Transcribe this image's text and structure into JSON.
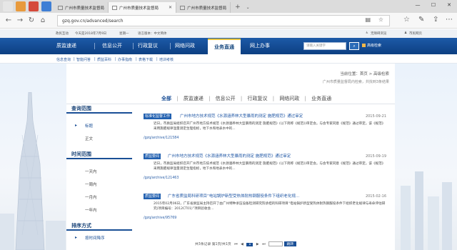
{
  "browser": {
    "tabs": [
      {
        "label": "广州市质量技术监督局",
        "active": false
      },
      {
        "label": "广州市质量技术监督局",
        "active": true
      },
      {
        "label": "广州市质量技术监督局",
        "active": false
      }
    ],
    "url": "gzq.gov.cn/advanced/search"
  },
  "topstrip": {
    "site": "政民互动",
    "date": "今天是2018年7月9日",
    "weekday": "星期一",
    "lang": "语言版本：中文简体",
    "accessible": "无障碍浏览",
    "site_visit": "市民网页"
  },
  "nav": {
    "items": [
      "质监速递",
      "信息公开",
      "行政复议",
      "网络问政",
      "业务直通",
      "网上办事"
    ],
    "search_placeholder": "请输入关键字",
    "advanced": "高级检索"
  },
  "subnav": [
    "信息查询",
    "智能问答",
    "质监百科",
    "办事指南",
    "表格下载",
    "培训考核"
  ],
  "breadcrumb": "当前位置：首页 > 高级检索",
  "crumb_sub": "广州市质量监督局内检索，共找到3条结果",
  "categories": [
    "全部",
    "质监速递",
    "信息公开",
    "行政复议",
    "网络问政",
    "业务直通"
  ],
  "sidebar": {
    "scope_title": "查询范围",
    "scope_items": [
      "标题",
      "正文"
    ],
    "time_title": "时间范围",
    "time_items": [
      "一天内",
      "一周内",
      "一月内",
      "一年内"
    ],
    "sort_title": "排序方式",
    "sort_items": [
      "按时间降序"
    ]
  },
  "results": [
    {
      "badge": "标准化监督工作",
      "title": "广州市地方技术规范《水源涵养林大型暴雨的测定 施肥规范》通过审定",
      "date": "2015-09-21",
      "body": "近日，市质监局组织召开广州市地方技术规范《水源涵养林大型暴雨的测定 施肥规范》(以下简称《规范》)审定会。与会专家同意《规范》通过审定。该《规范》采用施肥规律温量测定生理指标，地下水和地表水中的...",
      "link": "/gzq/archive/121584"
    },
    {
      "badge": "质监要闻",
      "title": "广州市地方技术规范《水源涵养林大型暴雨的测定 施肥规范》通过审定",
      "date": "2015-09-19",
      "body": "近日，市质监局组织召开广州市地方技术规范《水源涵养林大型暴雨的测定 施肥规范》(以下简称《规范》)审定会。与会专家同意《规范》通过审定。该《规范》采用施肥规律温量测定生理指标，地下水和地表水中的...",
      "link": "/gzq/archive/121463"
    },
    {
      "badge": "质监要闻",
      "title": "广东省质监局科研项目“电站锅炉新型受热体耐热钢服役条件下组织老化规...",
      "date": "2015-02-16",
      "body": "2015年02月06日，广东省质监局主持召开了由广州特种承压设备检测研究院承担的科研项目“电站锅炉新型受热体耐热钢服役条件下组织老化规律与寿命评估研究(项目编号：2012CT01)”项目验收会...",
      "link": "/gzq/archive/95769"
    }
  ],
  "pager": {
    "summary": "共3条记录 第1页/共1页",
    "current": "1",
    "go": "跳转"
  }
}
